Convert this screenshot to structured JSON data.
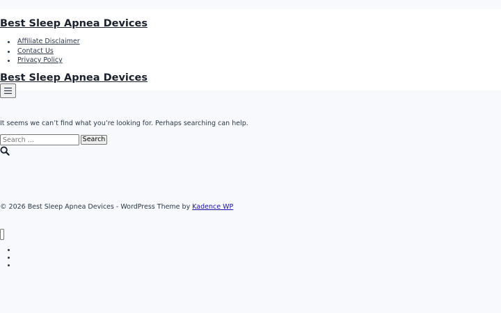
{
  "header": {
    "site_title": "Best Sleep Apnea Devices",
    "nav": {
      "items": [
        {
          "label": "Affiliate Disclaimer"
        },
        {
          "label": "Contact Us"
        },
        {
          "label": "Privacy Policy"
        }
      ]
    },
    "mobile_site_title": "Best Sleep Apnea Devices",
    "menu_toggle_icon": "hamburger-icon"
  },
  "main": {
    "message": "It seems we can’t find what you’re looking for. Perhaps searching can help.",
    "search": {
      "placeholder": "Search …",
      "value": "",
      "button_label": "Search",
      "icon": "search-icon"
    }
  },
  "footer": {
    "copyright": "© 2026 Best Sleep Apnea Devices - WordPress Theme by ",
    "theme_link": "Kadence WP"
  },
  "drawer": {
    "item_count_visible": 3
  },
  "colors": {
    "page_background": "#f7f9fc",
    "header_background": "#ffffff",
    "text": "#2d3748",
    "footer_link": "#1a0dab"
  }
}
